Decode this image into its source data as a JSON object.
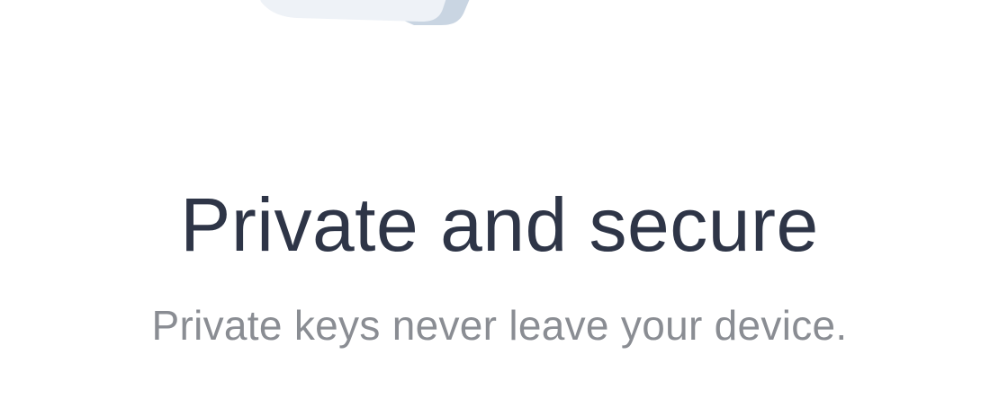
{
  "onboarding": {
    "illustration_icon": "device-illustration-icon",
    "title": "Private and secure",
    "subtitle": "Private keys never leave your device."
  },
  "colors": {
    "title": "#2e3547",
    "subtitle": "#8a8d93",
    "illustration_front": "#eef2f7",
    "illustration_side": "#c9d5e2",
    "background": "#ffffff"
  }
}
